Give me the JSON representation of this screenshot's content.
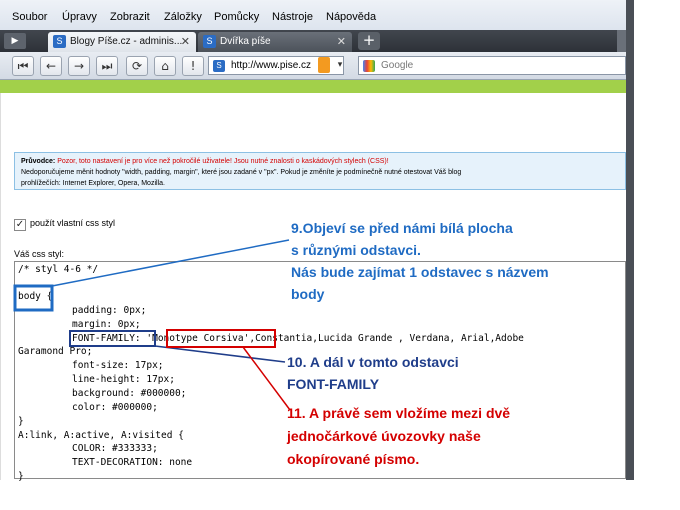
{
  "menu": [
    "Soubor",
    "Úpravy",
    "Zobrazit",
    "Záložky",
    "Pomůcky",
    "Nástroje",
    "Nápověda"
  ],
  "tabs": [
    {
      "label": "Blogy Píše.cz - adminis..."
    },
    {
      "label": "Dvířka píše"
    }
  ],
  "address": {
    "url": "http://www.pise.cz"
  },
  "search": {
    "placeholder": "Google"
  },
  "warning": {
    "title": "Průvodce:",
    "red_text": "Pozor, toto nastavení je pro více než pokročilé uživatele! Jsou nutné znalosti o kaskádových stylech (CSS)!",
    "line2": "Nedoporučujeme měnit hodnoty \"width, padding, margin\", které jsou zadané v \"px\". Pokud je změníte je podmínečně nutné otestovat Váš blog",
    "line3": "prohlížečích: Internet Explorer, Opera, Mozilla."
  },
  "checkbox": {
    "label": "použít vlastní css styl",
    "checked": true
  },
  "css_label": "Váš css styl:",
  "code": {
    "l1": "/* styl 4-6 */",
    "l2": "body {",
    "l3": "padding: 0px;",
    "l4": "margin: 0px;",
    "l5_prop": "FONT-FAMILY:",
    "l5_q1": "'",
    "l5_font": "Monotype Corsiva",
    "l5_rest": "',Constantia,Lucida Grande , Verdana, Arial,Adobe",
    "l6": "Garamond Pro;",
    "l7": "font-size: 17px;",
    "l8": "line-height: 17px;",
    "l9": "background: #000000;",
    "l10": "color: #000000;",
    "l11": "}",
    "l12": "A:link, A:active, A:visited {",
    "l13": "COLOR: #333333;",
    "l14": "TEXT-DECORATION: none",
    "l15": "}"
  },
  "annotations": {
    "a9_1": "9.Objeví se před námi bílá plocha",
    "a9_2": "s různými odstavci.",
    "a9_3": "Nás bude zajímat 1 odstavec s názvem",
    "a9_4": "body",
    "a10_1": "10. A dál v tomto odstavci",
    "a10_2": "FONT-FAMILY",
    "a11_1": "11. A právě sem vložíme mezi dvě",
    "a11_2": "jednočárkové úvozovky naše",
    "a11_3": "okopírované písmo."
  }
}
